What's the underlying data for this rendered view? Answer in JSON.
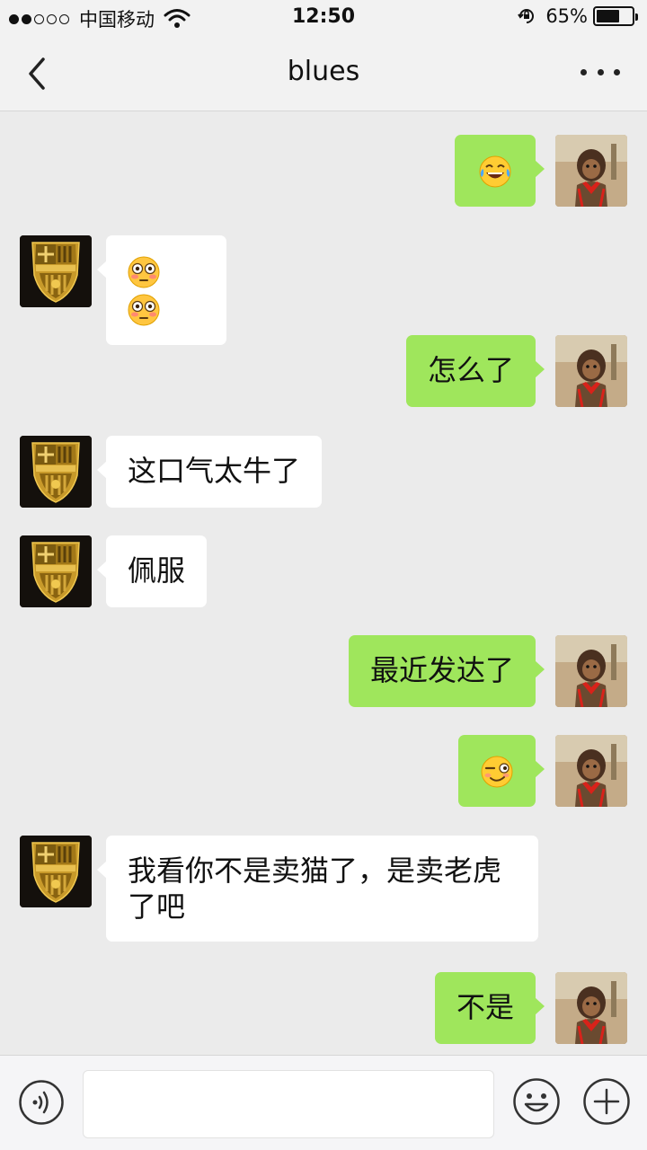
{
  "status_bar": {
    "carrier": "中国移动",
    "time": "12:50",
    "battery_percent": "65%",
    "battery_level": 0.65,
    "signal_bars": 2,
    "signal_total": 5
  },
  "nav": {
    "title": "blues",
    "back_icon": "chevron-left-icon",
    "more_icon": "more-dots-icon"
  },
  "messages": [
    {
      "sender": "me",
      "emoji": "tears-of-joy"
    },
    {
      "sender": "blues",
      "emoji": "flushed-flushed"
    },
    {
      "sender": "me",
      "text": "怎么了"
    },
    {
      "sender": "blues",
      "text": "这口气太牛了"
    },
    {
      "sender": "blues",
      "text": "佩服"
    },
    {
      "sender": "me",
      "text": "最近发达了"
    },
    {
      "sender": "me",
      "emoji": "sly-smile"
    },
    {
      "sender": "blues",
      "text": "我看你不是卖猫了，是卖老虎了吧"
    },
    {
      "sender": "me",
      "text": "不是"
    }
  ],
  "input_bar": {
    "text_value": "",
    "voice_icon": "voice-input-icon",
    "emoji_icon": "smiley-icon",
    "plus_icon": "plus-circle-icon"
  },
  "colors": {
    "background": "#ebebeb",
    "my_bubble": "#9fe65c",
    "their_bubble": "#ffffff",
    "bar": "#f2f2f2"
  }
}
